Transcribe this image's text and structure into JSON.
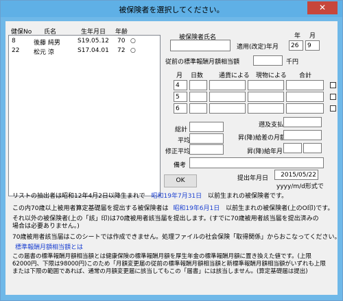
{
  "window": {
    "title": "被保険者を選択してください。",
    "close_label": "✕"
  },
  "list": {
    "headers": [
      "健保No",
      "氏名",
      "生年月日",
      "年齢"
    ],
    "rows": [
      {
        "no": "8",
        "name": "後藤 純男",
        "birth": "S19.05.12",
        "age": "70",
        "mark": "○"
      },
      {
        "no": "22",
        "name": "松元 涼",
        "birth": "S17.04.01",
        "age": "72",
        "mark": "○"
      }
    ]
  },
  "form": {
    "insured_name_label": "被保険者氏名",
    "insured_name_value": "",
    "year_header": "年",
    "month_header": "月",
    "applied_label": "適用(改定)年月",
    "applied_year": "26",
    "applied_month": "9",
    "prev_label": "従前の標準報酬月額相当額",
    "prev_value": "",
    "prev_unit": "千円",
    "table_headers": {
      "month": "月",
      "days": "日数",
      "currency": "通貨による",
      "goods": "現物による",
      "total": "合計"
    },
    "months": [
      "4",
      "5",
      "6"
    ],
    "sum_label": "総計",
    "sum_value": "",
    "avg_label": "平均",
    "avg_value": "",
    "adj_avg_label": "修正平均",
    "adj_avg_value": "",
    "retro_label": "遡及支払額",
    "retro_value": "",
    "raise_month_label": "昇(降)給差の月額",
    "raise_month_value": "",
    "raise_ym_label": "昇(降)給年月",
    "raise_year": "",
    "raise_month": "",
    "note_label": "備考",
    "note_value": "",
    "ok_label": "OK",
    "submit_label": "提出年月日",
    "submit_value": "2015/05/22",
    "submit_hint": "yyyy/m/d形式で"
  },
  "info": {
    "line1_a": "リストの抽出者は昭和12年4月2日以降生まれで",
    "line1_date": "昭和19年7月31日",
    "line1_b": "以前生まれの被保険者です。",
    "line2_a": "この内70歳以上被用者算定基礎届を提出する被保険者は",
    "line2_date": "昭和19年6月1日",
    "line2_b": "以前生まれの被保険者(上のO印)です。",
    "line3": "それ以外の被保険者(上の「該」印)は70歳被用者該当届を提出します。(すでに70歳被用者該当届を提出済みの場合は必要ありません。)",
    "line4": "70歳被用者該当届はこのシートでは作成できません。処理ファイルの社会保険「取得関係」からおこなってください。",
    "link": "標準報酬月額相当額とは",
    "explain": "この届書の標準報酬月額相当額とは健康保険の標準報酬月額を厚生年金の標準報酬月額に置き換えた値です。(上限62000円、下限は98000円)このため「月額変更届の従前の標準報酬月額相当額と新標準報酬月額相当額がいずれも上限または下限の範囲であれば、通常の月額変更届に該当してもこの「届書」には該当しません。(算定基礎届は提出)"
  },
  "colors": {
    "titlebar": "#5fb0e6",
    "close": "#c7463b",
    "link": "#1a3fd1",
    "face": "#f0f0f0"
  }
}
